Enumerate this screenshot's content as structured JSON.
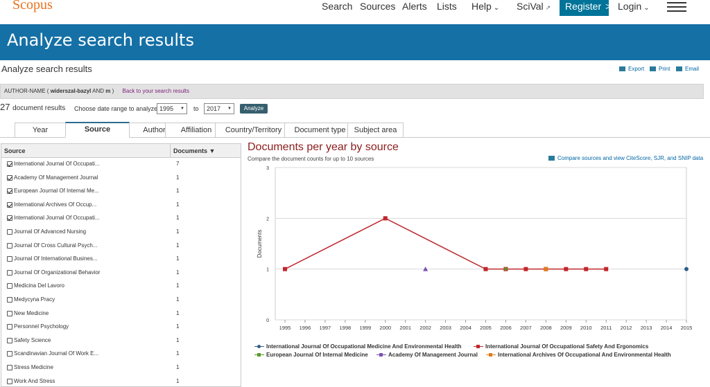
{
  "header": {
    "logo": "Scopus",
    "nav": [
      {
        "label": "Search"
      },
      {
        "label": "Sources"
      },
      {
        "label": "Alerts"
      },
      {
        "label": "Lists"
      },
      {
        "label": "Help"
      },
      {
        "label": "SciVal"
      }
    ],
    "register_label": "Register",
    "login_label": "Login"
  },
  "banner_title": "Analyze search results",
  "page_subtitle": "Analyze search results",
  "tools": {
    "export": "Export",
    "print": "Print",
    "email": "Email"
  },
  "query": {
    "prefix": "AUTHOR-NAME (",
    "term1": "widerszal-bazyl",
    "op": "AND",
    "term2": "m",
    "suffix": ")",
    "back_link": "Back to your search results"
  },
  "range": {
    "count": "27",
    "count_label": "document results",
    "choose_label": "Choose date range to analyze:",
    "from": "1995",
    "to_label": "to",
    "to": "2017",
    "analyze_label": "Analyze"
  },
  "tabs": [
    "Year",
    "Source",
    "Author",
    "Affiliation",
    "Country/Territory",
    "Document type",
    "Subject area"
  ],
  "active_tab": "Source",
  "table": {
    "col_source": "Source",
    "col_documents": "Documents",
    "rows": [
      {
        "name": "International Journal Of Occupati...",
        "docs": "7",
        "checked": true
      },
      {
        "name": "Academy Of Management Journal",
        "docs": "1",
        "checked": true
      },
      {
        "name": "European Journal Of Internal Me...",
        "docs": "1",
        "checked": true
      },
      {
        "name": "International Archives Of Occup...",
        "docs": "1",
        "checked": true
      },
      {
        "name": "International Journal Of Occupati...",
        "docs": "1",
        "checked": true
      },
      {
        "name": "Journal Of Advanced Nursing",
        "docs": "1",
        "checked": false
      },
      {
        "name": "Journal Of Cross Cultural Psych...",
        "docs": "1",
        "checked": false
      },
      {
        "name": "Journal Of International Busines...",
        "docs": "1",
        "checked": false
      },
      {
        "name": "Journal Of Organizational Behavior",
        "docs": "1",
        "checked": false
      },
      {
        "name": "Medicina Del Lavoro",
        "docs": "1",
        "checked": false
      },
      {
        "name": "Medycyna Pracy",
        "docs": "1",
        "checked": false
      },
      {
        "name": "New Medicine",
        "docs": "1",
        "checked": false
      },
      {
        "name": "Personnel Psychology",
        "docs": "1",
        "checked": false
      },
      {
        "name": "Safety Science",
        "docs": "1",
        "checked": false
      },
      {
        "name": "Scandinavian Journal Of Work E...",
        "docs": "1",
        "checked": false
      },
      {
        "name": "Stress Medicine",
        "docs": "1",
        "checked": false
      },
      {
        "name": "Work And Stress",
        "docs": "1",
        "checked": false
      }
    ]
  },
  "chart_title": "Documents per year by source",
  "chart_subtitle": "Compare the document counts for up to 10 sources",
  "compare_link": "Compare sources and view CiteScore, SJR, and SNIP data",
  "chart_data": {
    "type": "line",
    "ylabel": "Documents",
    "ylim": [
      0,
      3
    ],
    "yticks": [
      0,
      1,
      2,
      3
    ],
    "x": [
      "1995",
      "1996",
      "1997",
      "1998",
      "1999",
      "2000",
      "2001",
      "2002",
      "2003",
      "2004",
      "2005",
      "2006",
      "2007",
      "2008",
      "2009",
      "2010",
      "2011",
      "2012",
      "2013",
      "2014",
      "2015"
    ],
    "grid": true,
    "legend_position": "bottom",
    "series": [
      {
        "name": "International Journal Of Occupational Medicine And Environmental Health",
        "color": "#2f5f8a",
        "marker": "circle",
        "points": [
          {
            "x": "2015",
            "y": 1
          }
        ]
      },
      {
        "name": "International Journal Of Occupational Safety And Ergonomics",
        "color": "#c0272d",
        "marker": "square",
        "points": [
          {
            "x": "1995",
            "y": 1
          },
          {
            "x": "2000",
            "y": 2
          },
          {
            "x": "2005",
            "y": 1
          },
          {
            "x": "2006",
            "y": 1
          },
          {
            "x": "2007",
            "y": 1
          },
          {
            "x": "2008",
            "y": 1
          },
          {
            "x": "2009",
            "y": 1
          },
          {
            "x": "2010",
            "y": 1
          },
          {
            "x": "2011",
            "y": 1
          }
        ]
      },
      {
        "name": "European Journal Of Internal Medicine",
        "color": "#5a9a2a",
        "marker": "diamond",
        "points": [
          {
            "x": "2006",
            "y": 1
          }
        ]
      },
      {
        "name": "Academy Of Management Journal",
        "color": "#7b4fb3",
        "marker": "triangle",
        "points": [
          {
            "x": "2002",
            "y": 1
          }
        ]
      },
      {
        "name": "International Archives Of Occupational And Environmental Health",
        "color": "#e07b1f",
        "marker": "square",
        "points": [
          {
            "x": "2008",
            "y": 1
          }
        ]
      }
    ]
  }
}
